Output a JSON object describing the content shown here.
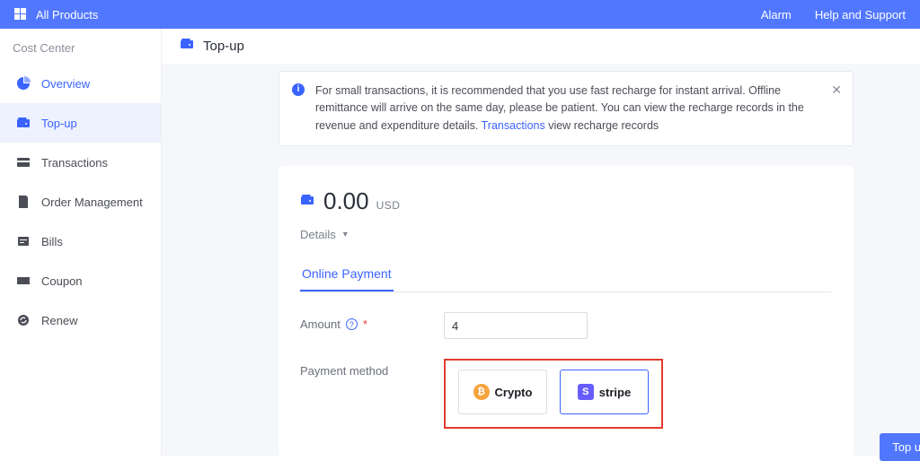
{
  "topbar": {
    "title": "All Products",
    "alarm": "Alarm",
    "help": "Help and Support"
  },
  "sidebar": {
    "section": "Cost Center",
    "items": [
      {
        "label": "Overview"
      },
      {
        "label": "Top-up"
      },
      {
        "label": "Transactions"
      },
      {
        "label": "Order Management"
      },
      {
        "label": "Bills"
      },
      {
        "label": "Coupon"
      },
      {
        "label": "Renew"
      }
    ]
  },
  "page": {
    "title": "Top-up"
  },
  "notice": {
    "text_before_link": "For small transactions, it is recommended that you use fast recharge for instant arrival. Offline remittance will arrive on the same day, please be patient. You can view the recharge records in the revenue and expenditure details. ",
    "link": "Transactions",
    "text_after_link": " view recharge records"
  },
  "balance": {
    "amount": "0.00",
    "currency": "USD",
    "details_label": "Details"
  },
  "tabs": {
    "online_payment": "Online Payment"
  },
  "form": {
    "amount_label": "Amount",
    "amount_value": "4",
    "method_label": "Payment method",
    "methods": {
      "crypto": "Crypto",
      "stripe": "stripe"
    }
  },
  "cta": {
    "label": "Top up Immediately"
  }
}
